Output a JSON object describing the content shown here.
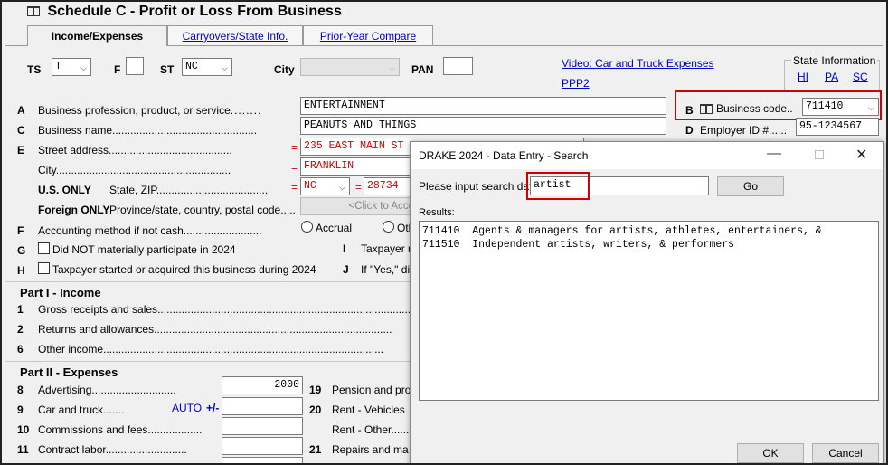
{
  "form": {
    "title": "Schedule C - Profit or Loss From Business",
    "tabs": [
      {
        "label": "Income/Expenses"
      },
      {
        "label": "Carryovers/State Info."
      },
      {
        "label": "Prior-Year Compare"
      }
    ],
    "top_row": {
      "ts_label": "TS",
      "ts_value": "T",
      "f_label": "F",
      "st_label": "ST",
      "st_value": "NC",
      "city_label": "City",
      "pan_label": "PAN"
    },
    "links": {
      "video": "Video: Car and Truck Expenses",
      "ppp2": "PPP2"
    },
    "state_info": {
      "label": "State Information",
      "states": [
        "HI",
        "PA",
        "SC"
      ]
    },
    "lines": {
      "a_letter": "A",
      "a_label": "Business profession, product, or service",
      "a_value": "ENTERTAINMENT",
      "b_letter": "B",
      "b_label": "Business code",
      "b_value": "711410",
      "c_letter": "C",
      "c_label": "Business name",
      "c_value": "PEANUTS AND THINGS",
      "d_letter": "D",
      "d_label": "Employer ID #",
      "d_value": "95-1234567",
      "e_letter": "E",
      "e_label": "Street address",
      "e_value": "235 EAST MAIN ST",
      "city_label": "City",
      "city_value": "FRANKLIN",
      "us_only": "U.S. ONLY",
      "state_zip_label": "State, ZIP",
      "state_value": "NC",
      "zip_value": "28734",
      "foreign_only": "Foreign ONLY",
      "foreign_label": "Province/state, country, postal code",
      "foreign_placeholder": "<Click to Acce",
      "f_letter": "F",
      "f_label": "Accounting method if not cash",
      "accrual_label": "Accrual",
      "other_label": "Oth",
      "g_letter": "G",
      "g_label": "Did NOT materially participate in 2024",
      "h_letter": "H",
      "h_label": "Taxpayer started or acquired this business during 2024",
      "i_letter": "I",
      "i_label": "Taxpayer r",
      "j_letter": "J",
      "j_label": "If \"Yes,\" di"
    },
    "part1": {
      "title": "Part I - Income",
      "rows": [
        {
          "num": "1",
          "label": "Gross receipts and sales"
        },
        {
          "num": "2",
          "label": "Returns and allowances"
        },
        {
          "num": "6",
          "label": "Other income"
        }
      ]
    },
    "part2": {
      "title": "Part II - Expenses",
      "rows": [
        {
          "num": "8",
          "label": "Advertising",
          "value": "2000"
        },
        {
          "num": "9",
          "label": "Car and truck",
          "auto": "AUTO",
          "plusminus": "+/-"
        },
        {
          "num": "10",
          "label": "Commissions and fees"
        },
        {
          "num": "11",
          "label": "Contract labor"
        }
      ],
      "right_rows": [
        {
          "num": "19",
          "label": "Pension and pro"
        },
        {
          "num": "20",
          "label": "Rent - Vehicles"
        },
        {
          "num": "",
          "label": "Rent - Other"
        },
        {
          "num": "21",
          "label": "Repairs and ma"
        }
      ]
    }
  },
  "dialog": {
    "title": "DRAKE 2024 - Data Entry - Search",
    "prompt": "Please input search data:",
    "search_value": "artist",
    "go_label": "Go",
    "results_label": "Results:",
    "results": [
      "711410  Agents & managers for artists, athletes, entertainers, &",
      "711510  Independent artists, writers, & performers"
    ],
    "ok_label": "OK",
    "cancel_label": "Cancel"
  }
}
